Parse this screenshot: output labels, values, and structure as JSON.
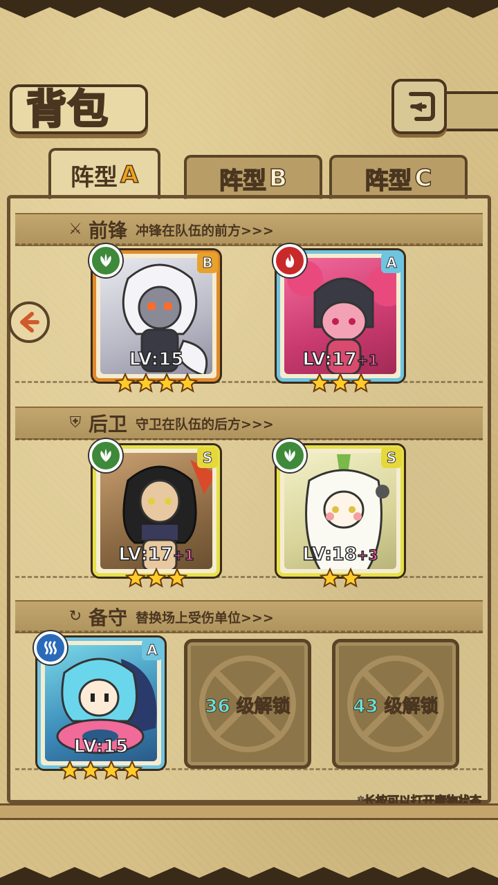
{
  "header": {
    "title": "背包",
    "back_icon": "return-arrow-icon"
  },
  "tabs": [
    {
      "label": "阵型",
      "letter": "A",
      "active": true
    },
    {
      "label": "阵型",
      "letter": "B",
      "active": false
    },
    {
      "label": "阵型",
      "letter": "C",
      "active": false
    }
  ],
  "sections": {
    "front": {
      "title": "前锋",
      "desc": "冲锋在队伍的前方>>>",
      "icon": "sword-icon"
    },
    "back": {
      "title": "后卫",
      "desc": "守卫在队伍的后方>>>",
      "icon": "shield-icon"
    },
    "reserve": {
      "title": "备守",
      "desc": "替换场上受伤单位>>>",
      "icon": "swap-icon"
    }
  },
  "cards": [
    {
      "lv": "LV:15",
      "plus": "",
      "rank": "B",
      "element": "leaf",
      "stars": 4,
      "frame": "#e08a2c"
    },
    {
      "lv": "LV:17",
      "plus": "+1",
      "rank": "A",
      "element": "fire",
      "stars": 3,
      "frame": "#6fc4e0"
    },
    {
      "lv": "LV:17",
      "plus": "+1",
      "rank": "S",
      "element": "leaf",
      "stars": 3,
      "frame": "#e6e04a"
    },
    {
      "lv": "LV:18",
      "plus": "+3",
      "rank": "S",
      "element": "leaf",
      "stars": 2,
      "frame": "#e6e04a"
    },
    {
      "lv": "LV:15",
      "plus": "",
      "rank": "A",
      "element": "water",
      "stars": 4,
      "frame": "#6fc4e0"
    }
  ],
  "locked_slots": [
    {
      "level": "36",
      "text": "级解锁"
    },
    {
      "level": "43",
      "text": "级解锁"
    }
  ],
  "footnote": "*长按可以打开魔物状态"
}
